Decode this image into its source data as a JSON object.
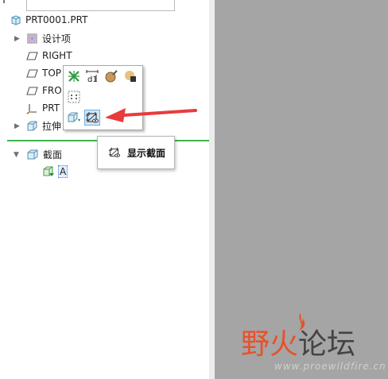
{
  "tree": {
    "root": "PRT0001.PRT",
    "items": [
      {
        "label": "设计项",
        "icon": "design-items-icon"
      },
      {
        "label": "RIGHT",
        "icon": "datum-plane-icon"
      },
      {
        "label": "TOP",
        "icon": "datum-plane-icon"
      },
      {
        "label": "FRO",
        "icon": "datum-plane-icon"
      },
      {
        "label": "PRT",
        "icon": "csys-icon"
      },
      {
        "label": "拉伸",
        "icon": "extrude-icon"
      }
    ],
    "section_group": "截面",
    "section_item": "A"
  },
  "mini_toolbar": {
    "buttons": [
      "feature-icon",
      "dimension-icon",
      "appearance-icon",
      "shading-icon",
      "select-pattern-icon",
      "edit-section-icon",
      "show-section-icon"
    ]
  },
  "tooltip": {
    "label": "显示截面"
  },
  "watermark": {
    "title_part1": "野火",
    "title_part2": "论坛",
    "url": "www.proewildfire.cn"
  },
  "colors": {
    "canvas": "#a5a5a5",
    "divider": "#3fb34f",
    "arrow": "#e83b3b",
    "highlight": "#cfe8fb"
  }
}
